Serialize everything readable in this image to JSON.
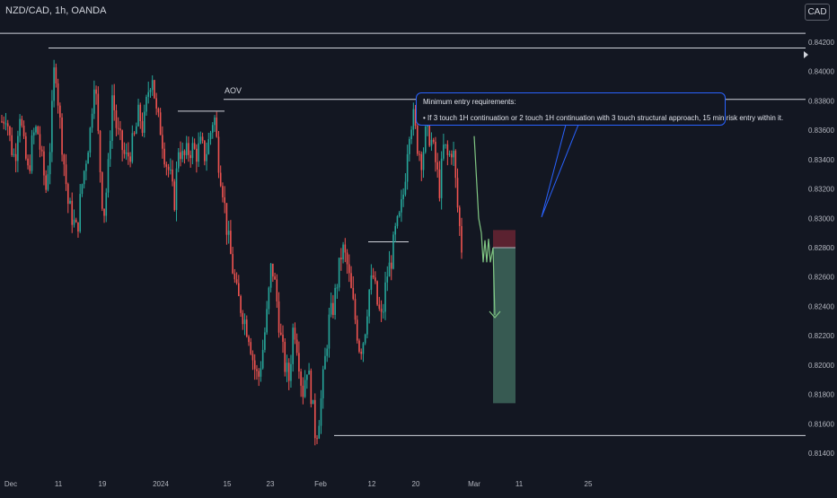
{
  "header": {
    "symbol_line": "NZD/CAD, 1h, OANDA",
    "currency": "CAD"
  },
  "annotations": {
    "aov_label": "AOV",
    "callout_title": "Minimum entry requirements:",
    "callout_body": "• If 3 touch 1H continuation or 2 touch 1H continuation with 3 touch structural approach, 15 min risk entry within it."
  },
  "colors": {
    "background": "#131722",
    "up": "#26a69a",
    "down": "#ef5350",
    "level_line": "#d1d4dc",
    "callout_border": "#2962ff",
    "stop_zone": "#5b2230",
    "target_zone": "#375a52",
    "projection": "#81c784"
  },
  "chart_data": {
    "type": "line",
    "title": "",
    "xlabel": "",
    "ylabel": "",
    "x_ticks": [
      "Dec",
      "11",
      "19",
      "2024",
      "15",
      "23",
      "Feb",
      "12",
      "20",
      "Mar",
      "11",
      "25"
    ],
    "y_ticks": [
      "0.84200",
      "0.84000",
      "0.83800",
      "0.83600",
      "0.83400",
      "0.83200",
      "0.83000",
      "0.82800",
      "0.82600",
      "0.82400",
      "0.82200",
      "0.82000",
      "0.81800",
      "0.81600",
      "0.81400"
    ],
    "ylim": [
      0.8135,
      0.8428
    ],
    "grid": false,
    "series": [
      {
        "values": [
          0.8366,
          0.8372,
          0.835,
          0.834,
          0.8375,
          0.8348,
          0.833,
          0.8355,
          0.8362,
          0.834,
          0.832,
          0.8352,
          0.841,
          0.837,
          0.834,
          0.831,
          0.83,
          0.829,
          0.832,
          0.834,
          0.836,
          0.84,
          0.8345,
          0.83,
          0.833,
          0.8385,
          0.836,
          0.835,
          0.834,
          0.8345,
          0.8355,
          0.8372,
          0.836,
          0.8385,
          0.84,
          0.837,
          0.836,
          0.834,
          0.833,
          0.831,
          0.835,
          0.834,
          0.8345,
          0.8348,
          0.8344,
          0.835,
          0.8342,
          0.8355,
          0.8372,
          0.834,
          0.832,
          0.829,
          0.827,
          0.825,
          0.824,
          0.823,
          0.822,
          0.82,
          0.819,
          0.821,
          0.8235,
          0.827,
          0.825,
          0.822,
          0.82,
          0.819,
          0.823,
          0.821,
          0.818,
          0.82,
          0.818,
          0.815,
          0.817,
          0.82,
          0.823,
          0.824,
          0.826,
          0.828,
          0.827,
          0.825,
          0.823,
          0.821,
          0.822,
          0.825,
          0.826,
          0.824,
          0.823,
          0.826,
          0.827,
          0.829,
          0.83,
          0.832,
          0.836,
          0.837,
          0.835,
          0.834,
          0.836,
          0.8355,
          0.834,
          0.832,
          0.835,
          0.834,
          0.835,
          0.831,
          0.828
        ]
      },
      {
        "values": [
          0.8356,
          0.83,
          0.829,
          0.827,
          0.8285,
          0.827,
          0.8286,
          0.827,
          0.828
        ]
      }
    ]
  },
  "levels": [
    {
      "name": "top-range",
      "price": 0.8426
    },
    {
      "name": "december-high",
      "price": 0.8416
    },
    {
      "name": "aov",
      "price": 0.8381
    },
    {
      "name": "january-high",
      "price": 0.8373
    },
    {
      "name": "february-resistance",
      "price": 0.8284
    },
    {
      "name": "low",
      "price": 0.8152
    }
  ],
  "position": {
    "entry": 0.828,
    "stop": 0.8292,
    "target": 0.8174
  }
}
